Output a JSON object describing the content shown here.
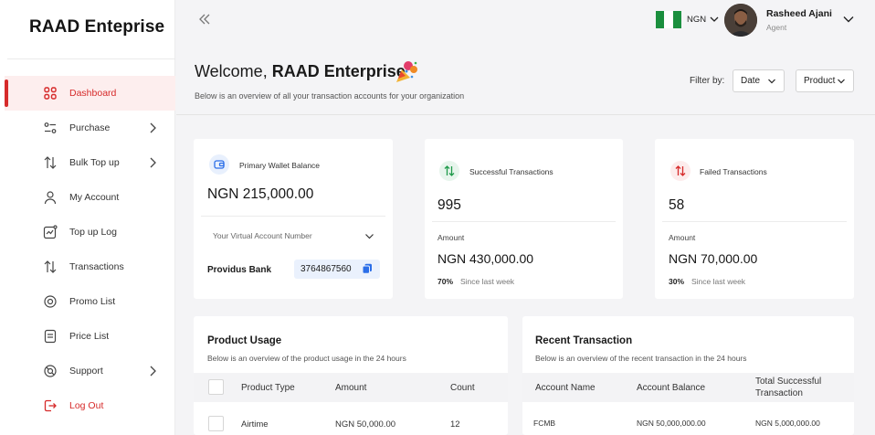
{
  "brand": "RAAD Enteprise",
  "sidebar": {
    "items": [
      {
        "label": "Dashboard",
        "icon": "grid-icon",
        "active": true
      },
      {
        "label": "Purchase",
        "icon": "toggle-icon",
        "chevron": true
      },
      {
        "label": "Bulk Top up",
        "icon": "arrows-updown-icon",
        "chevron": true
      },
      {
        "label": "My Account",
        "icon": "user-icon"
      },
      {
        "label": "Top up Log",
        "icon": "chart-log-icon"
      },
      {
        "label": "Transactions",
        "icon": "arrows-updown-icon"
      },
      {
        "label": "Promo List",
        "icon": "promo-icon"
      },
      {
        "label": "Price List",
        "icon": "list-icon"
      },
      {
        "label": "Support",
        "icon": "support-icon",
        "chevron": true
      },
      {
        "label": "Log Out",
        "icon": "logout-icon",
        "danger": true
      }
    ]
  },
  "topbar": {
    "currency": "NGN",
    "user_name": "Rasheed Ajani",
    "user_role": "Agent"
  },
  "welcome": {
    "title_prefix": "Welcome, ",
    "title_name": "RAAD Enterprise",
    "subtitle": "Below is an overview of all your transaction accounts for your organization",
    "filter_label": "Filter by:",
    "filter_date": "Date",
    "filter_product": "Product"
  },
  "wallet": {
    "label": "Primary Wallet Balance",
    "balance": "NGN 215,000.00",
    "va_placeholder": "Your Virtual Account Number",
    "bank": "Providus Bank",
    "account_number": "3764867560"
  },
  "successful": {
    "label": "Successful Transactions",
    "count": "995",
    "amount_label": "Amount",
    "amount": "NGN 430,000.00",
    "pct": "70%",
    "since": "Since last week"
  },
  "failed": {
    "label": "Failed Transactions",
    "count": "58",
    "amount_label": "Amount",
    "amount": "NGN 70,000.00",
    "pct": "30%",
    "since": "Since last week"
  },
  "product_usage": {
    "title": "Product Usage",
    "subtitle": "Below is an overview of the product usage in the 24 hours",
    "columns": [
      "Product Type",
      "Amount",
      "Count"
    ],
    "rows": [
      [
        "Airtime",
        "NGN 50,000.00",
        "12"
      ]
    ]
  },
  "recent": {
    "title": "Recent Transaction",
    "subtitle": "Below is an overview of the recent transaction in the 24 hours",
    "columns": [
      "Account Name",
      "Account Balance",
      "Total Successful",
      "Transaction"
    ],
    "rows": [
      [
        "FCMB",
        "NGN 50,000,000.00",
        "NGN 5,000,000.00"
      ]
    ]
  },
  "colors": {
    "accent": "#d62a2a",
    "success": "#1f9a4a",
    "link": "#2b6ee8"
  }
}
